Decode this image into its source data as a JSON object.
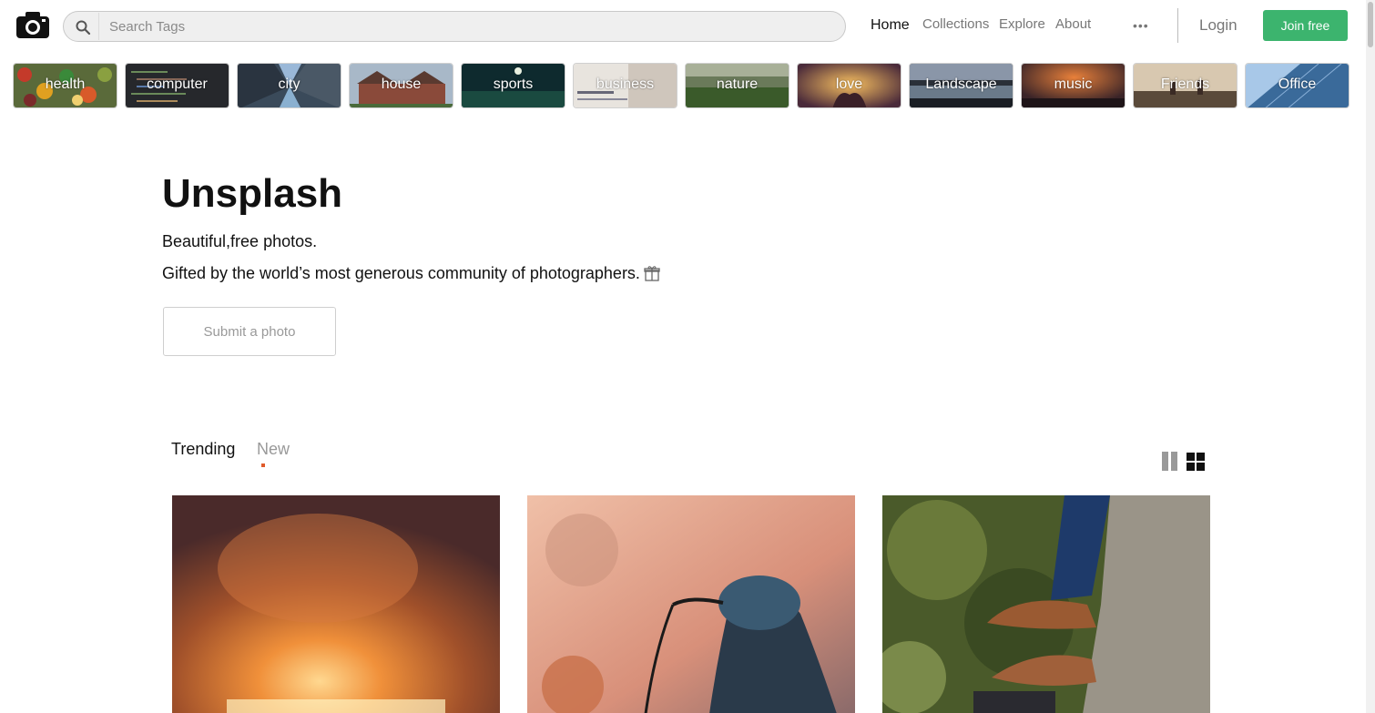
{
  "header": {
    "search_placeholder": "Search Tags",
    "nav": [
      "Home",
      "Collections",
      "Explore",
      "About"
    ],
    "more": "•••",
    "login": "Login",
    "join": "Join free"
  },
  "tags": [
    "health",
    "computer",
    "city",
    "house",
    "sports",
    "business",
    "nature",
    "love",
    "Landscape",
    "music",
    "Friends",
    "Office"
  ],
  "hero": {
    "title": "Unsplash",
    "subtitle1": "Beautiful,free photos.",
    "subtitle2": "Gifted by the world’s most generous community of photographers.",
    "submit": "Submit a photo"
  },
  "tabs": {
    "trending": "Trending",
    "new": "New"
  },
  "colors": {
    "accent": "#3cb46e",
    "tab_indicator": "#e05a2a"
  }
}
